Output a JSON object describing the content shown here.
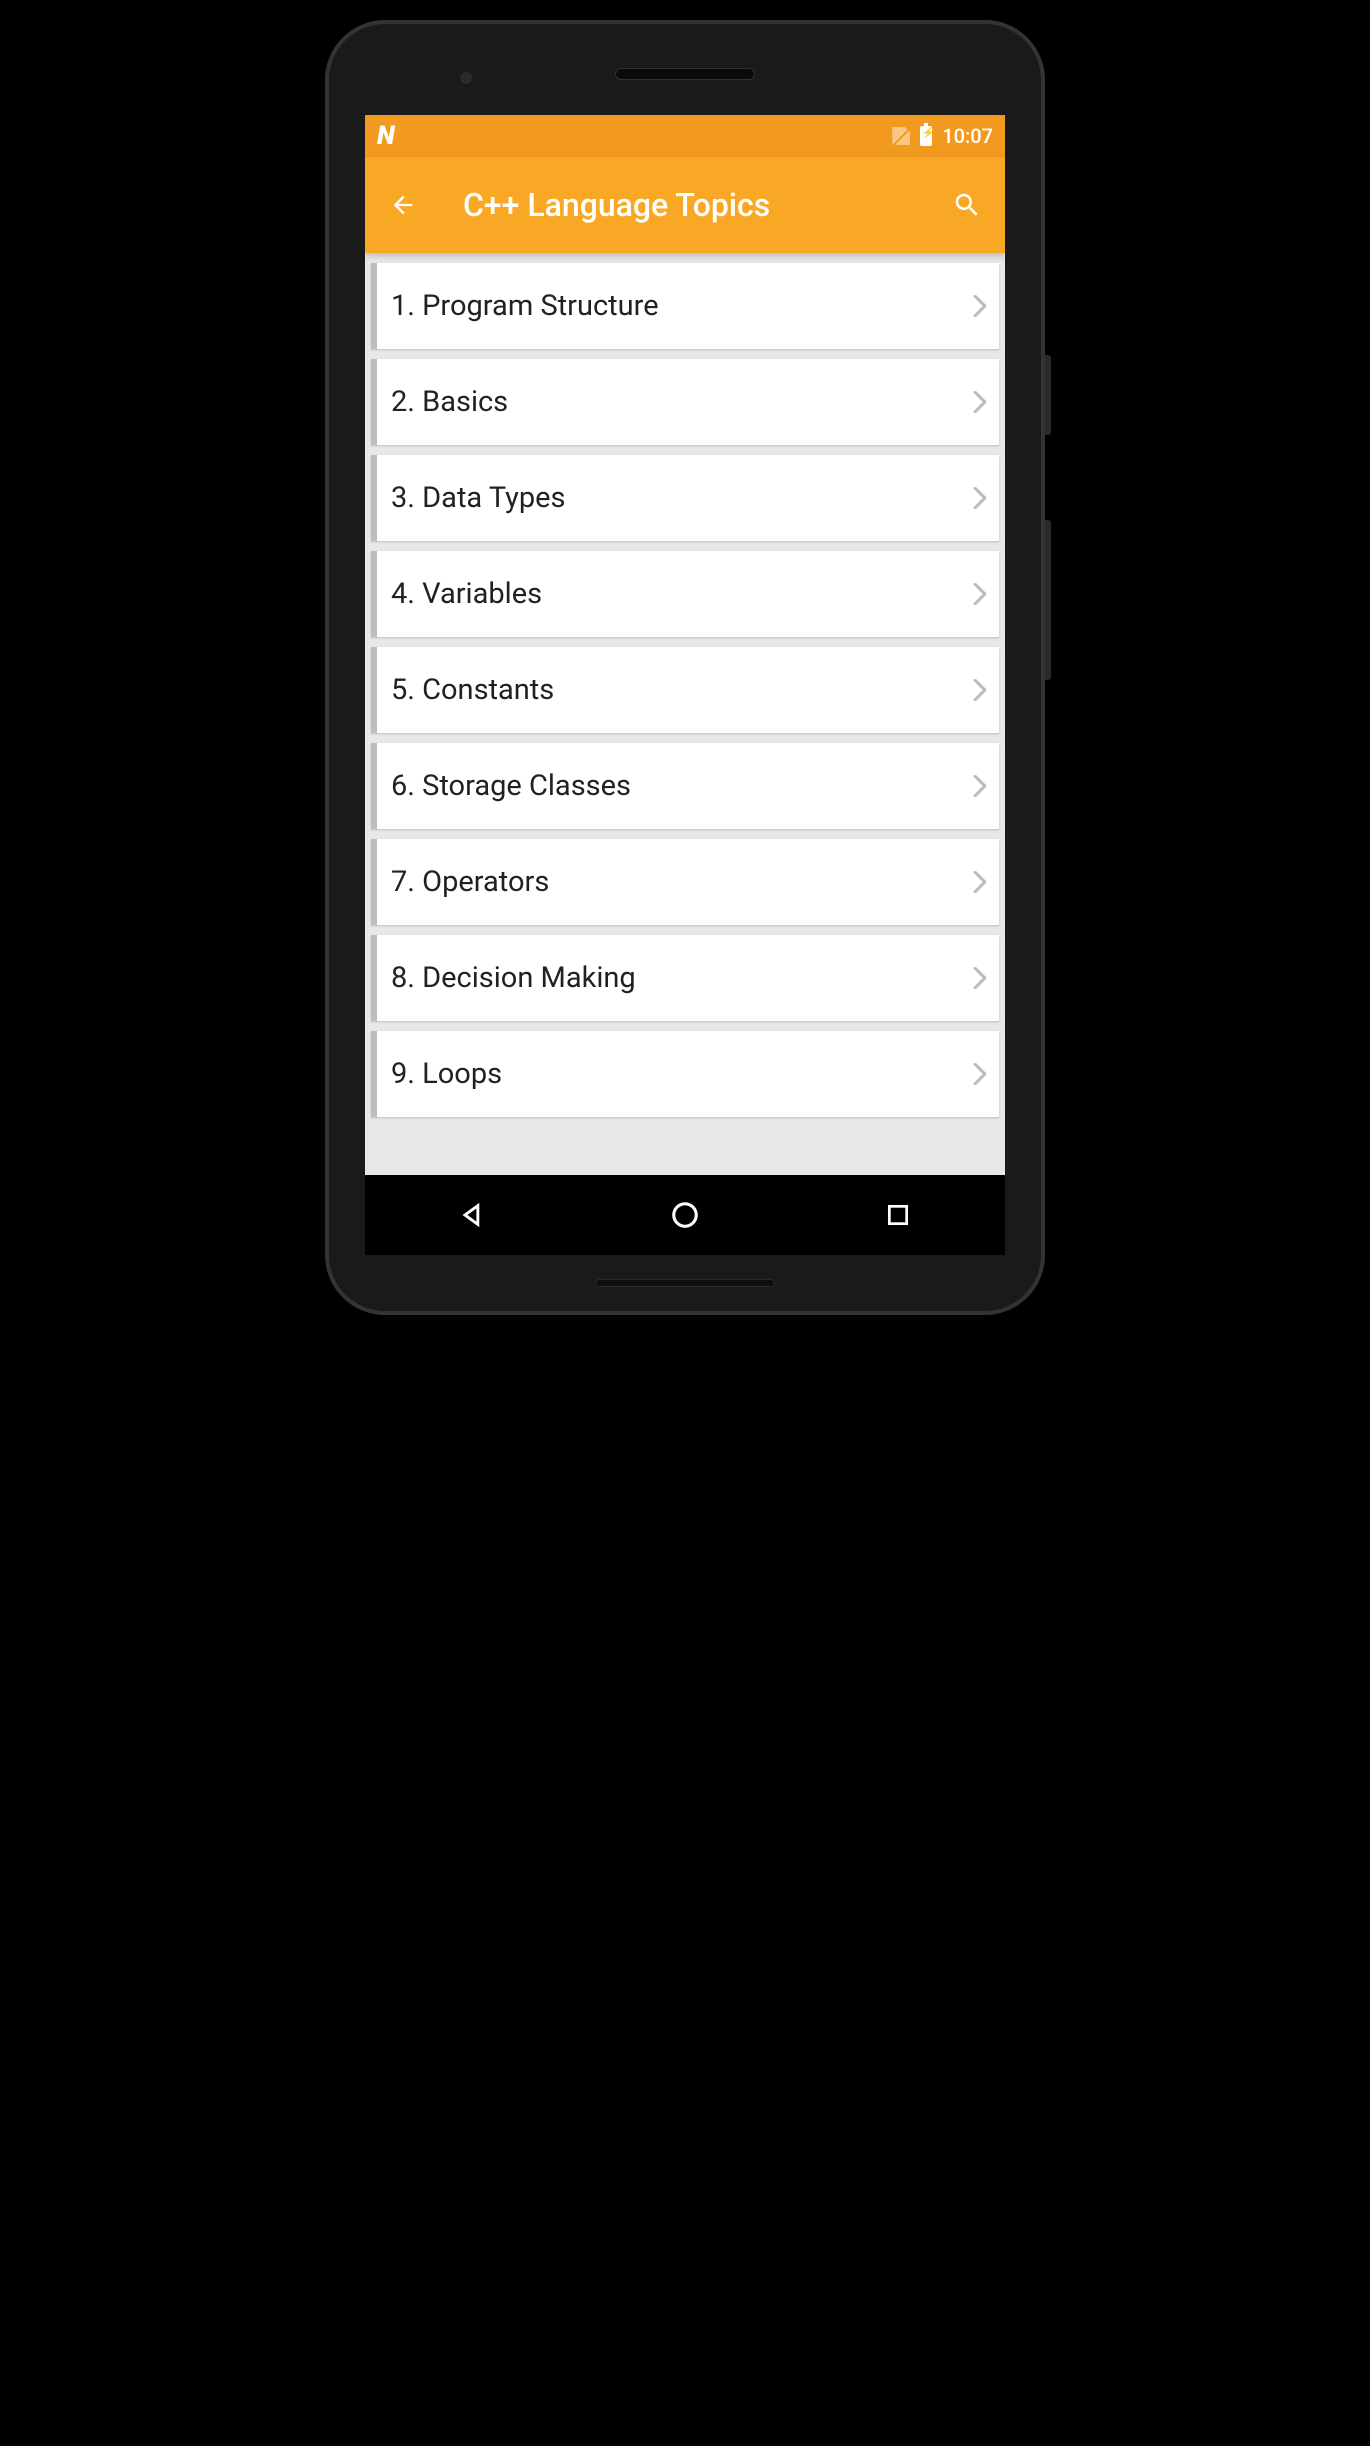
{
  "status": {
    "time": "10:07"
  },
  "header": {
    "title": "C++ Language Topics"
  },
  "topics": [
    {
      "label": "1. Program Structure"
    },
    {
      "label": "2. Basics"
    },
    {
      "label": "3. Data Types"
    },
    {
      "label": "4. Variables"
    },
    {
      "label": "5. Constants"
    },
    {
      "label": "6. Storage Classes"
    },
    {
      "label": "7. Operators"
    },
    {
      "label": "8. Decision Making"
    },
    {
      "label": "9. Loops"
    }
  ]
}
